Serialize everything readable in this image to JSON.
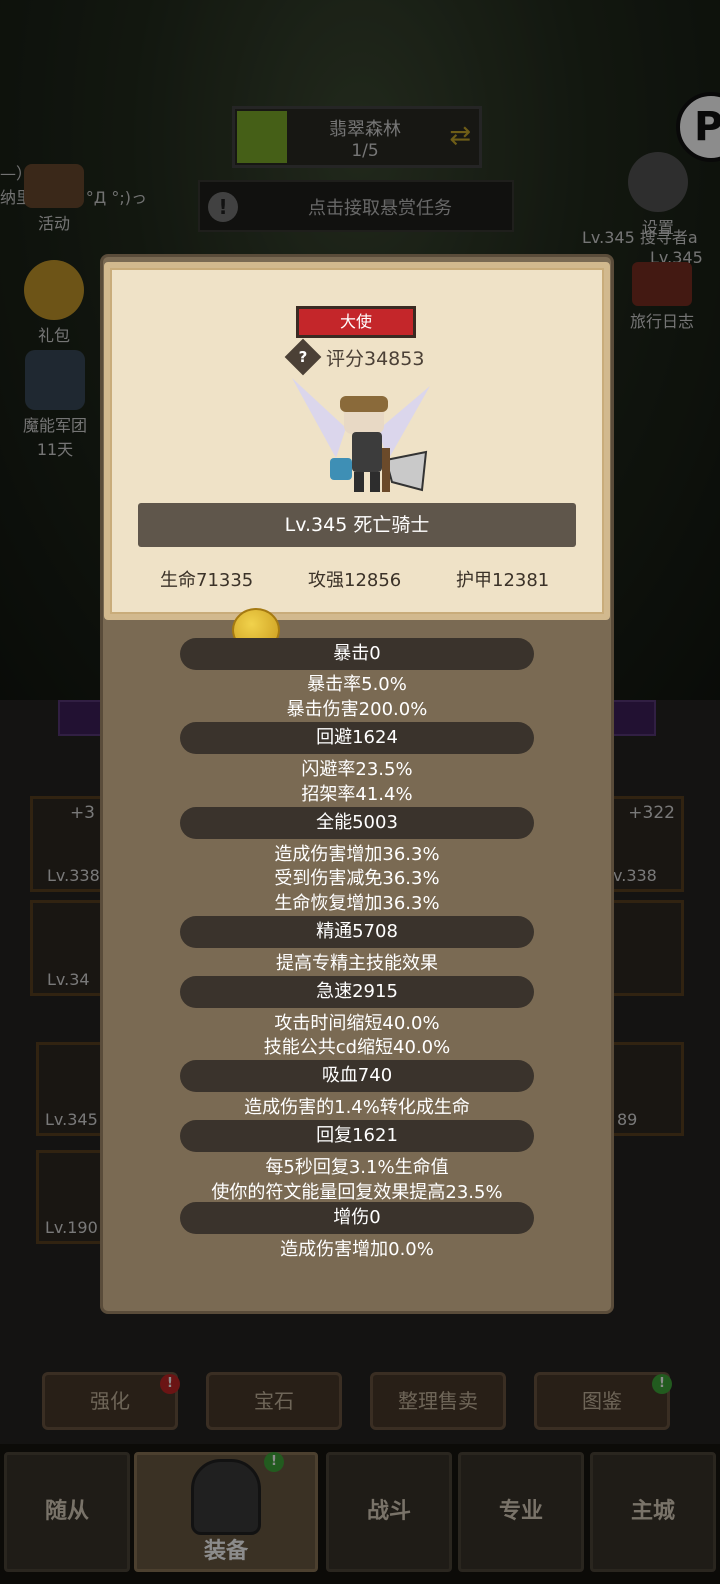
{
  "stage": {
    "name": "翡翠森林",
    "progress": "1/5",
    "swap_icon": "refresh-icon"
  },
  "bounty": {
    "text": "点击接取悬赏任务",
    "alert": "!"
  },
  "chat": {
    "text": "纳里奥: (っ °Д °;)っ",
    "tail": "—）"
  },
  "left_menu": [
    {
      "label": "活动",
      "icon": "event-icon"
    },
    {
      "label": "礼包",
      "icon": "gift-icon"
    },
    {
      "label": "魔能军团",
      "sub": "11天",
      "icon": "legion-icon"
    }
  ],
  "right_menu": [
    {
      "label": "设置",
      "icon": "gear-icon"
    },
    {
      "label": "旅行日志",
      "icon": "journal-icon"
    }
  ],
  "right_info": {
    "line1": "Lv.345 搜寻者a",
    "line2": "Lv.345"
  },
  "logo_letter": "P",
  "equip_slots": [
    {
      "lv": "Lv.338",
      "plus": "+3"
    },
    {
      "lv": "Lv.34"
    },
    {
      "lv": "v.338",
      "plus": "+322"
    },
    {
      "lv": ""
    }
  ],
  "inventory": [
    {
      "lv": "Lv.345"
    },
    {
      "lv": "Lv.190"
    },
    {
      "lv": "89"
    }
  ],
  "actions": [
    {
      "label": "强化",
      "badge": "!"
    },
    {
      "label": "宝石"
    },
    {
      "label": "整理售卖"
    },
    {
      "label": "图鉴",
      "badge": "!"
    }
  ],
  "nav": [
    {
      "label": "随从"
    },
    {
      "label": "装备",
      "badge": "!"
    },
    {
      "label": "战斗"
    },
    {
      "label": "专业"
    },
    {
      "label": "主城"
    }
  ],
  "hero": {
    "title": "大使",
    "score_help": "?",
    "score": "评分34853",
    "name": "Lv.345 死亡骑士",
    "hp": "生命71335",
    "atk": "攻强12856",
    "armor": "护甲12381"
  },
  "stats": [
    {
      "header": "暴击0",
      "lines": [
        "暴击率5.0%",
        "暴击伤害200.0%"
      ]
    },
    {
      "header": "回避1624",
      "lines": [
        "闪避率23.5%",
        "招架率41.4%"
      ]
    },
    {
      "header": "全能5003",
      "lines": [
        "造成伤害增加36.3%",
        "受到伤害减免36.3%",
        "生命恢复增加36.3%"
      ]
    },
    {
      "header": "精通5708",
      "lines": [
        "提高专精主技能效果"
      ]
    },
    {
      "header": "急速2915",
      "lines": [
        "攻击时间缩短40.0%",
        "技能公共cd缩短40.0%"
      ]
    },
    {
      "header": "吸血740",
      "lines": [
        "造成伤害的1.4%转化成生命"
      ]
    },
    {
      "header": "回复1621",
      "lines": [
        "每5秒回复3.1%生命值",
        "使你的符文能量回复效果提高23.5%"
      ]
    },
    {
      "header": "增伤0",
      "lines": [
        "造成伤害增加0.0%"
      ]
    }
  ]
}
